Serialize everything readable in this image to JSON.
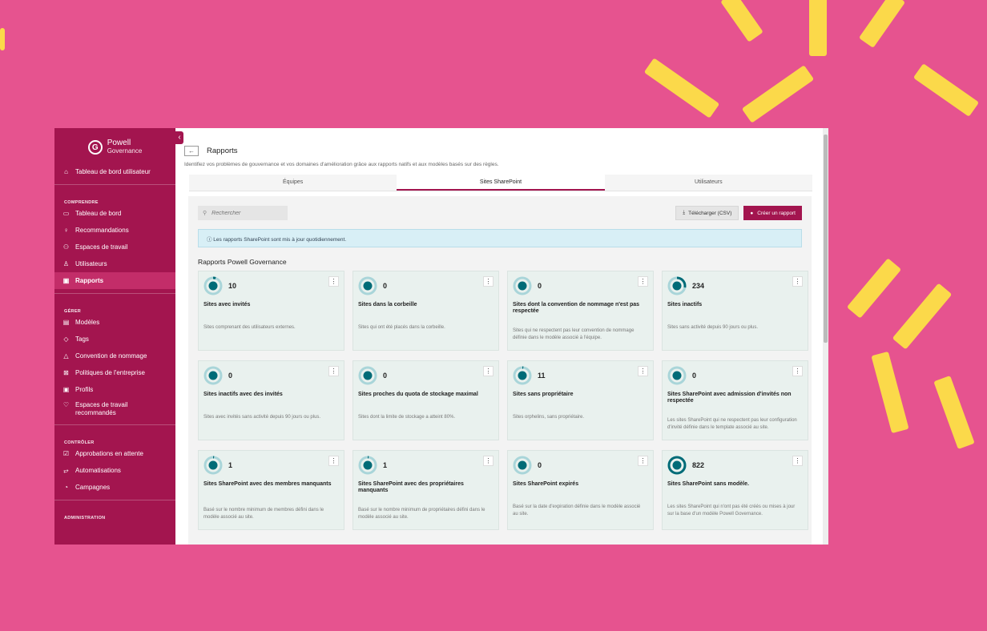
{
  "sidebar": {
    "logo": {
      "mark": "G",
      "line1": "Powell",
      "line2": "Governance"
    },
    "dashboard_item": {
      "icon": "home-icon",
      "label": "Tableau de bord utilisateur"
    },
    "sections": [
      {
        "title": "COMPRENDRE",
        "items": [
          {
            "icon": "monitor-icon",
            "label": "Tableau de bord"
          },
          {
            "icon": "lightbulb-icon",
            "label": "Recommandations"
          },
          {
            "icon": "people-icon",
            "label": "Espaces de travail"
          },
          {
            "icon": "user-icon",
            "label": "Utilisateurs"
          },
          {
            "icon": "report-icon",
            "label": "Rapports"
          }
        ]
      },
      {
        "title": "GÉRER",
        "items": [
          {
            "icon": "template-icon",
            "label": "Modèles"
          },
          {
            "icon": "tag-icon",
            "label": "Tags"
          },
          {
            "icon": "naming-icon",
            "label": "Convention de nommage"
          },
          {
            "icon": "policy-icon",
            "label": "Politiques de l'entreprise"
          },
          {
            "icon": "profile-icon",
            "label": "Profils"
          },
          {
            "icon": "heart-icon",
            "label": "Espaces de travail recommandés"
          }
        ]
      },
      {
        "title": "CONTRÔLER",
        "items": [
          {
            "icon": "approval-icon",
            "label": "Approbations en attente"
          },
          {
            "icon": "automation-icon",
            "label": "Automatisations"
          },
          {
            "icon": "campaign-icon",
            "label": "Campagnes"
          }
        ]
      },
      {
        "title": "ADMINISTRATION",
        "items": []
      }
    ]
  },
  "header": {
    "back_label": "←",
    "title": "Rapports",
    "subtitle": "Identifiez vos problèmes de gouvernance et vos domaines d'amélioration grâce aux rapports natifs et aux modèles basés sur des règles."
  },
  "tabs": [
    {
      "label": "Équipes"
    },
    {
      "label": "Sites SharePoint"
    },
    {
      "label": "Utilisateurs"
    }
  ],
  "toolbar": {
    "search_placeholder": "Rechercher",
    "csv_label": "Télécharger (CSV)",
    "create_label": "Créer un rapport"
  },
  "info_text": "ⓘ Les rapports SharePoint sont mis à jour quotidiennement.",
  "section_title": "Rapports Powell Governance",
  "menu_glyph": "⋮",
  "colors": {
    "accent": "#a3154f",
    "donut_fill": "#006b77",
    "donut_track": "#a9d5d9"
  },
  "cards": [
    {
      "count": "10",
      "fill": 0.05,
      "title": "Sites avec invités",
      "desc": "Sites comprenant des utilisateurs externes."
    },
    {
      "count": "0",
      "fill": 0,
      "title": "Sites dans la corbeille",
      "desc": "Sites qui ont été placés dans la corbeille."
    },
    {
      "count": "0",
      "fill": 0,
      "title": "Sites dont la convention de nommage n'est pas respectée",
      "desc": "Sites qui ne respectent pas leur convention de nommage définie dans le modèle associé à l'équipe."
    },
    {
      "count": "234",
      "fill": 0.28,
      "title": "Sites inactifs",
      "desc": "Sites sans activité depuis 90 jours ou plus."
    },
    {
      "count": "0",
      "fill": 0,
      "title": "Sites inactifs avec des invités",
      "desc": "Sites avec invités sans activité depuis 90 jours ou plus."
    },
    {
      "count": "0",
      "fill": 0,
      "title": "Sites proches du quota de stockage maximal",
      "desc": "Sites dont la limite de stockage a atteint 80%."
    },
    {
      "count": "11",
      "fill": 0.02,
      "title": "Sites sans propriétaire",
      "desc": "Sites orphelins, sans propriétaire."
    },
    {
      "count": "0",
      "fill": 0,
      "title": "Sites SharePoint avec admission d'invités non respectée",
      "desc": "Les sites SharePoint qui ne respectent pas leur configuration d'invité définie dans le template associé au site."
    },
    {
      "count": "1",
      "fill": 0.005,
      "title": "Sites SharePoint avec des membres manquants",
      "desc": "Basé sur le nombre minimum de membres défini dans le modèle associé au site."
    },
    {
      "count": "1",
      "fill": 0.005,
      "title": "Sites SharePoint avec des propriétaires manquants",
      "desc": "Basé sur le nombre minimum de propriétaires défini dans le modèle associé au site."
    },
    {
      "count": "0",
      "fill": 0,
      "title": "Sites SharePoint expirés",
      "desc": "Basé sur la date d'expiration définie dans le modèle associé au site."
    },
    {
      "count": "822",
      "fill": 1,
      "title": "Sites SharePoint sans modèle.",
      "desc": "Les sites SharePoint qui n'ont pas été créés ou mises à jour sur la base d'un modèle Powell Governance."
    }
  ]
}
